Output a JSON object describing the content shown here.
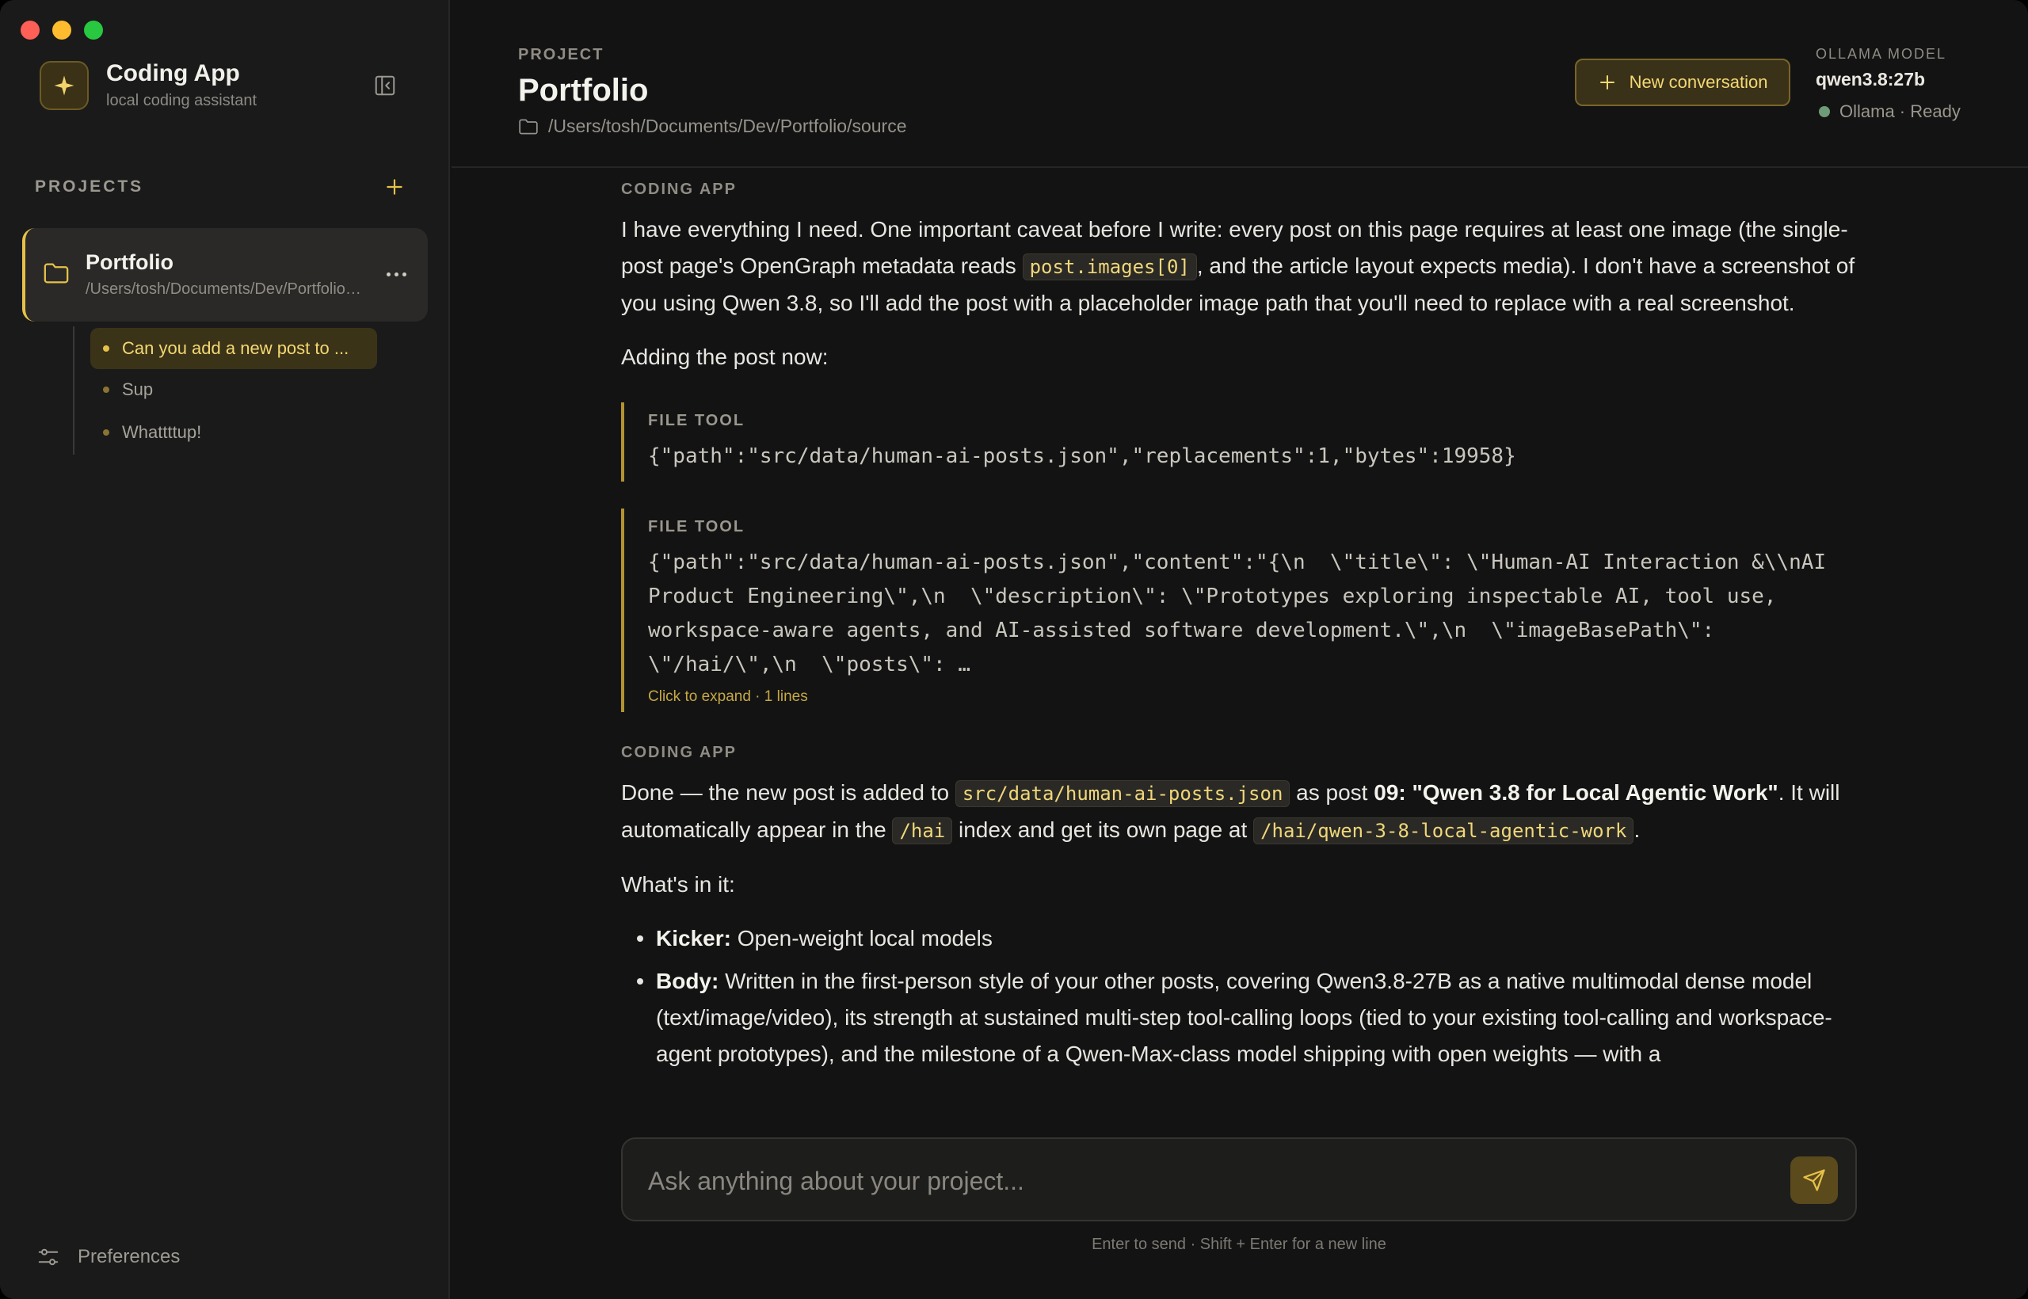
{
  "app": {
    "name": "Coding App",
    "subtitle": "local coding assistant"
  },
  "sidebar": {
    "projects_title": "PROJECTS",
    "project": {
      "name": "Portfolio",
      "path": "/Users/tosh/Documents/Dev/Portfolio/source"
    },
    "conversations": [
      {
        "label": "Can you add a new post to ...",
        "active": true
      },
      {
        "label": "Sup",
        "active": false
      },
      {
        "label": "Whattttup!",
        "active": false
      }
    ],
    "preferences_label": "Preferences"
  },
  "header": {
    "project_label": "PROJECT",
    "project_title": "Portfolio",
    "project_path": "/Users/tosh/Documents/Dev/Portfolio/source",
    "new_conversation_label": "New conversation",
    "model_label": "OLLAMA MODEL",
    "model_name": "qwen3.8:27b",
    "model_status": "Ollama · Ready"
  },
  "messages": {
    "msg1": {
      "role": "CODING APP",
      "p1_a": "I have everything I need. One important caveat before I write: every post on this page requires at least one image (the single-post page's OpenGraph metadata reads ",
      "p1_code": "post.images[0]",
      "p1_b": ", and the article layout expects media). I don't have a screenshot of you using Qwen 3.8, so I'll add the post with a placeholder image path that you'll need to replace with a real screenshot.",
      "p2": "Adding the post now:"
    },
    "tool1": {
      "label": "FILE TOOL",
      "code": "{\"path\":\"src/data/human-ai-posts.json\",\"replacements\":1,\"bytes\":19958}"
    },
    "tool2": {
      "label": "FILE TOOL",
      "code": "{\"path\":\"src/data/human-ai-posts.json\",\"content\":\"{\\n  \\\"title\\\": \\\"Human-AI Interaction &\\\\nAI Product Engineering\\\",\\n  \\\"description\\\": \\\"Prototypes exploring inspectable AI, tool use, workspace-aware agents, and AI-assisted software development.\\\",\\n  \\\"imageBasePath\\\": \\\"/hai/\\\",\\n  \\\"posts\\\": …",
      "expand": "Click to expand · 1 lines"
    },
    "msg2": {
      "role": "CODING APP",
      "p1_a": "Done — the new post is added to ",
      "p1_code1": "src/data/human-ai-posts.json",
      "p1_b": " as post ",
      "p1_bold": "09: \"Qwen 3.8 for Local Agentic Work\"",
      "p1_c": ". It will automatically appear in the ",
      "p1_code2": "/hai",
      "p1_d": " index and get its own page at ",
      "p1_code3": "/hai/qwen-3-8-local-agentic-work",
      "p1_e": ".",
      "p2": "What's in it:",
      "bullets": [
        {
          "key": "Kicker:",
          "text": " Open-weight local models"
        },
        {
          "key": "Body:",
          "text": " Written in the first-person style of your other posts, covering Qwen3.8-27B as a native multimodal dense model (text/image/video), its strength at sustained multi-step tool-calling loops (tied to your existing tool-calling and workspace-agent prototypes), and the milestone of a Qwen-Max-class model shipping with open weights — with a"
        }
      ]
    }
  },
  "composer": {
    "placeholder": "Ask anything about your project...",
    "hint": "Enter to send · Shift + Enter for a new line"
  },
  "colors": {
    "accent": "#e6c14a",
    "background": "#131313",
    "sidebar": "#1a1a1a",
    "status_ready": "#6f9c78"
  }
}
